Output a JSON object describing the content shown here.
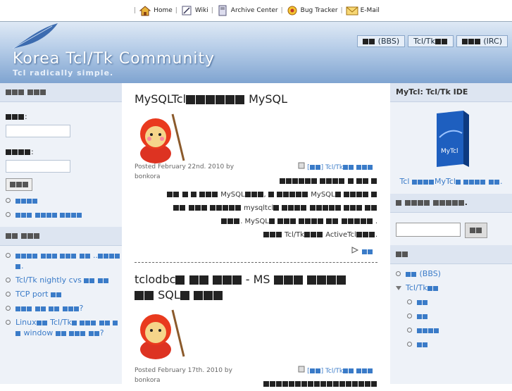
{
  "topnav": {
    "items": [
      {
        "label": "Home",
        "icon": "home-icon"
      },
      {
        "label": "Wiki",
        "icon": "wiki-icon"
      },
      {
        "label": "Archive Center",
        "icon": "archive-icon"
      },
      {
        "label": "Bug Tracker",
        "icon": "bug-icon"
      },
      {
        "label": "E-Mail",
        "icon": "mail-icon"
      }
    ]
  },
  "header": {
    "title": "Korea Tcl/Tk Community",
    "subtitle": "Tcl radically simple.",
    "tabs": [
      {
        "prefix": "",
        "label": "(BBS)"
      },
      {
        "prefix": "Tcl/Tk",
        "label": ""
      },
      {
        "prefix": "",
        "label": "(IRC)"
      }
    ]
  },
  "left": {
    "login_button_label": "",
    "links": [],
    "categories": [
      {
        "text": "",
        "suffix": ""
      },
      {
        "text": "Tcl/Tk nightly cvs",
        "suffix": ""
      },
      {
        "text": "TCP port",
        "suffix": ""
      },
      {
        "text": "",
        "suffix": "?"
      },
      {
        "text": "Linux",
        "suffix": "Tcl/Tk",
        "tail": "window"
      },
      {
        "text": "",
        "suffix": "?"
      }
    ]
  },
  "posts": [
    {
      "title_prefix": "MySQLTcl",
      "title_suffix": "MySQL",
      "meta_posted": "Posted February 22nd. 2010 by",
      "meta_author": "bonkora",
      "tag": "Tcl/Tk",
      "body_words": [
        "MySQL",
        "MySQL",
        "mysqltcl",
        "MySQL",
        "Tcl/Tk",
        "ActiveTcl"
      ]
    },
    {
      "title_prefix": "tclodbc",
      "title_mid": "- MS",
      "title_suffix": "SQL",
      "meta_posted": "Posted February 17th. 2010 by",
      "meta_author": "bonkora",
      "tag": "Tcl/Tk"
    }
  ],
  "right": {
    "ide_header": "MyTcl: Tcl/Tk IDE",
    "ide_caption_a": "Tcl",
    "ide_caption_b": "MyTcl",
    "box_label": "MyTcl",
    "nav": [
      {
        "text": "(BBS)"
      },
      {
        "text": "Tcl/Tk"
      }
    ]
  },
  "colors": {
    "accent": "#3a7bc8",
    "sidebar": "#eef2f8",
    "banner_top": "#dfe9f5",
    "banner_bottom": "#7ea3d0"
  }
}
